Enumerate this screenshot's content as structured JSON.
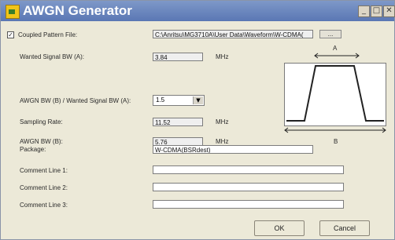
{
  "window": {
    "title": "AWGN Generator"
  },
  "title_buttons": {
    "minimize": "_",
    "maximize": "□",
    "close": "✕"
  },
  "coupled_pattern": {
    "checked_mark": "✓",
    "label": "Coupled Pattern File:",
    "value": "C:\\Anritsu\\MG3710A\\User Data\\Waveform\\W-CDMA(",
    "browse_label": "..."
  },
  "wanted_bw": {
    "label": "Wanted Signal BW (A):",
    "value": "3.84",
    "unit": "MHz"
  },
  "ratio": {
    "label": "AWGN BW (B) / Wanted Signal BW (A):",
    "value": "1.5",
    "arrow": "▼"
  },
  "sampling": {
    "label": "Sampling Rate:",
    "value": "11.52",
    "unit": "MHz"
  },
  "awgn_bw": {
    "label": "AWGN BW (B):",
    "value": "5.76",
    "unit": "MHz"
  },
  "diagram": {
    "label_a": "A",
    "label_b": "B"
  },
  "package": {
    "label": "Package:",
    "value": "W-CDMA(BSRdest)"
  },
  "comments": [
    {
      "label": "Comment Line 1:",
      "value": ""
    },
    {
      "label": "Comment Line 2:",
      "value": ""
    },
    {
      "label": "Comment Line 3:",
      "value": ""
    }
  ],
  "buttons": {
    "ok": "OK",
    "cancel": "Cancel"
  }
}
